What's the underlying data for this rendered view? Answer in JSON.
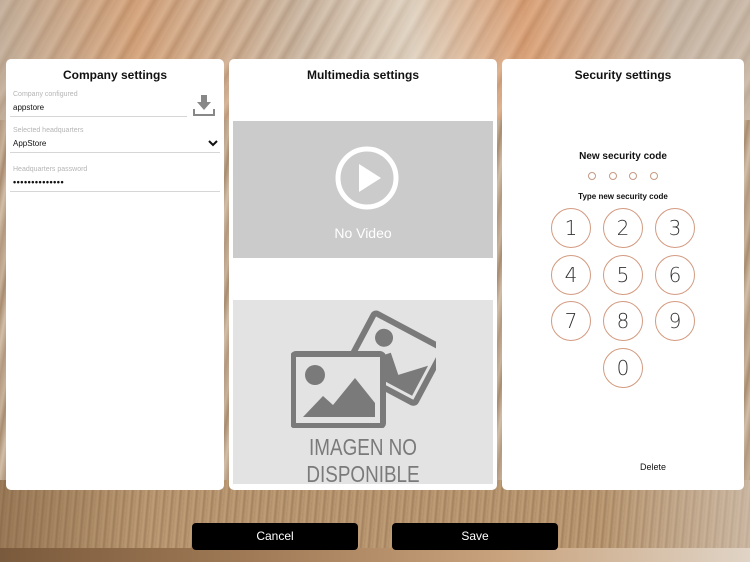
{
  "company": {
    "title": "Company settings",
    "company_configured_label": "Company configured",
    "company_configured_value": "appstore",
    "download_icon": "download-icon",
    "headquarters_label": "Selected headquarters",
    "headquarters_value": "AppStore",
    "chevron_icon": "chevron-down-icon",
    "password_label": "Headquarters password",
    "password_value": "••••••••••••••"
  },
  "multimedia": {
    "title": "Multimedia settings",
    "video_icon": "play-circle-icon",
    "video_text": "No Video",
    "image_icon": "image-placeholder-icon",
    "image_text": "IMAGEN NO DISPONIBLE"
  },
  "security": {
    "title": "Security settings",
    "new_code_label": "New security code",
    "entered_digits": 0,
    "code_length": 4,
    "type_prompt": "Type new security code",
    "keys": [
      "1",
      "2",
      "3",
      "4",
      "5",
      "6",
      "7",
      "8",
      "9",
      "0"
    ],
    "delete_label": "Delete",
    "accent_color": "#d39a80"
  },
  "footer": {
    "cancel_label": "Cancel",
    "save_label": "Save"
  }
}
